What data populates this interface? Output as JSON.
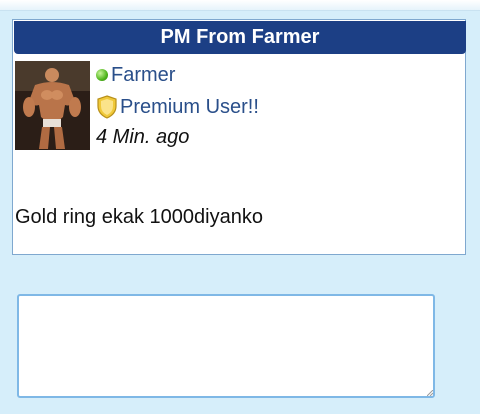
{
  "pm": {
    "title": "PM From Farmer",
    "sender": {
      "name": "Farmer",
      "status": "online",
      "status_color": "#4fb51c",
      "avatar_icon": "bodybuilder-avatar"
    },
    "rank": {
      "icon": "shield-badge-icon",
      "label": "Premium User!!"
    },
    "time": "4 Min. ago",
    "message": "Gold ring ekak 1000diyanko"
  },
  "reply": {
    "value": "",
    "placeholder": ""
  },
  "colors": {
    "header_bg": "#1c3f85",
    "page_bg": "#d6eefa",
    "link": "#2a4f8a"
  }
}
